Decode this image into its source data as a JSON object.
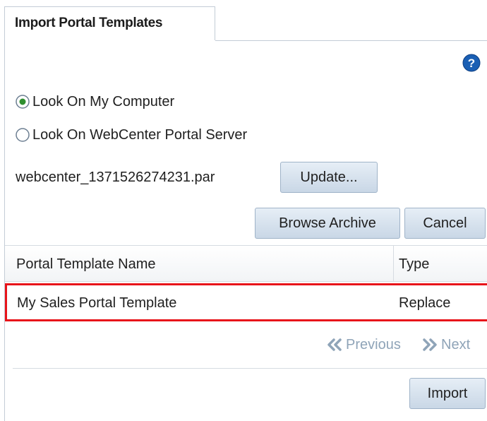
{
  "tab": {
    "title": "Import Portal Templates"
  },
  "source_options": [
    {
      "label": "Look On My Computer",
      "selected": true
    },
    {
      "label": "Look On WebCenter Portal Server",
      "selected": false
    }
  ],
  "archive": {
    "file_name": "webcenter_1371526274231.par",
    "update_label": "Update...",
    "browse_label": "Browse Archive",
    "cancel_label": "Cancel"
  },
  "table": {
    "columns": [
      "Portal Template Name",
      "Type"
    ],
    "rows": [
      {
        "name": "My Sales Portal Template",
        "type": "Replace",
        "highlighted": true
      }
    ]
  },
  "pagination": {
    "previous_label": "Previous",
    "next_label": "Next"
  },
  "footer": {
    "import_label": "Import"
  },
  "colors": {
    "accent_blue": "#1a5fb4",
    "button_border": "#9fb3c8",
    "highlight_border": "#e8141a",
    "disabled_text": "#8fa4b8"
  },
  "icons": {
    "help": "help-icon",
    "radio_selected": "radio-selected-icon",
    "radio_unselected": "radio-unselected-icon",
    "previous": "double-chevron-left-icon",
    "next": "double-chevron-right-icon"
  }
}
